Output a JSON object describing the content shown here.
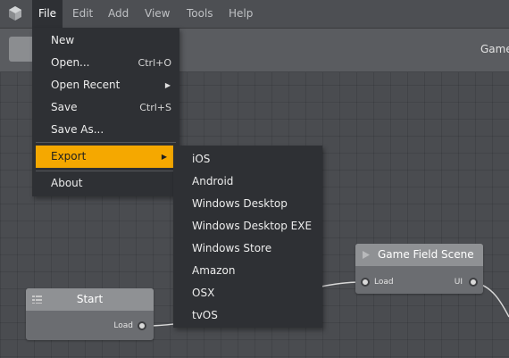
{
  "menubar": {
    "items": [
      "File",
      "Edit",
      "Add",
      "View",
      "Tools",
      "Help"
    ],
    "active": "File"
  },
  "toolbar": {
    "scene_tab": "Game"
  },
  "file_menu": {
    "items": [
      {
        "label": "New",
        "shortcut": ""
      },
      {
        "label": "Open...",
        "shortcut": "Ctrl+O"
      },
      {
        "label": "Open Recent",
        "shortcut": ""
      },
      {
        "label": "Save",
        "shortcut": "Ctrl+S"
      },
      {
        "label": "Save As...",
        "shortcut": ""
      },
      {
        "label": "Export",
        "shortcut": ""
      },
      {
        "label": "About",
        "shortcut": ""
      }
    ],
    "highlighted": "Export"
  },
  "export_menu": {
    "items": [
      "iOS",
      "Android",
      "Windows Desktop",
      "Windows Desktop EXE",
      "Windows Store",
      "Amazon",
      "OSX",
      "tvOS"
    ]
  },
  "nodes": {
    "start": {
      "title": "Start",
      "out_port": "Load"
    },
    "game_field_scene": {
      "title": "Game Field Scene",
      "in_port": "Load",
      "out_port": "UI"
    }
  },
  "colors": {
    "highlight": "#f5a800",
    "menu_bg": "#2e3034",
    "canvas_bg": "#4a4c50",
    "node_header": "#8f9194"
  }
}
